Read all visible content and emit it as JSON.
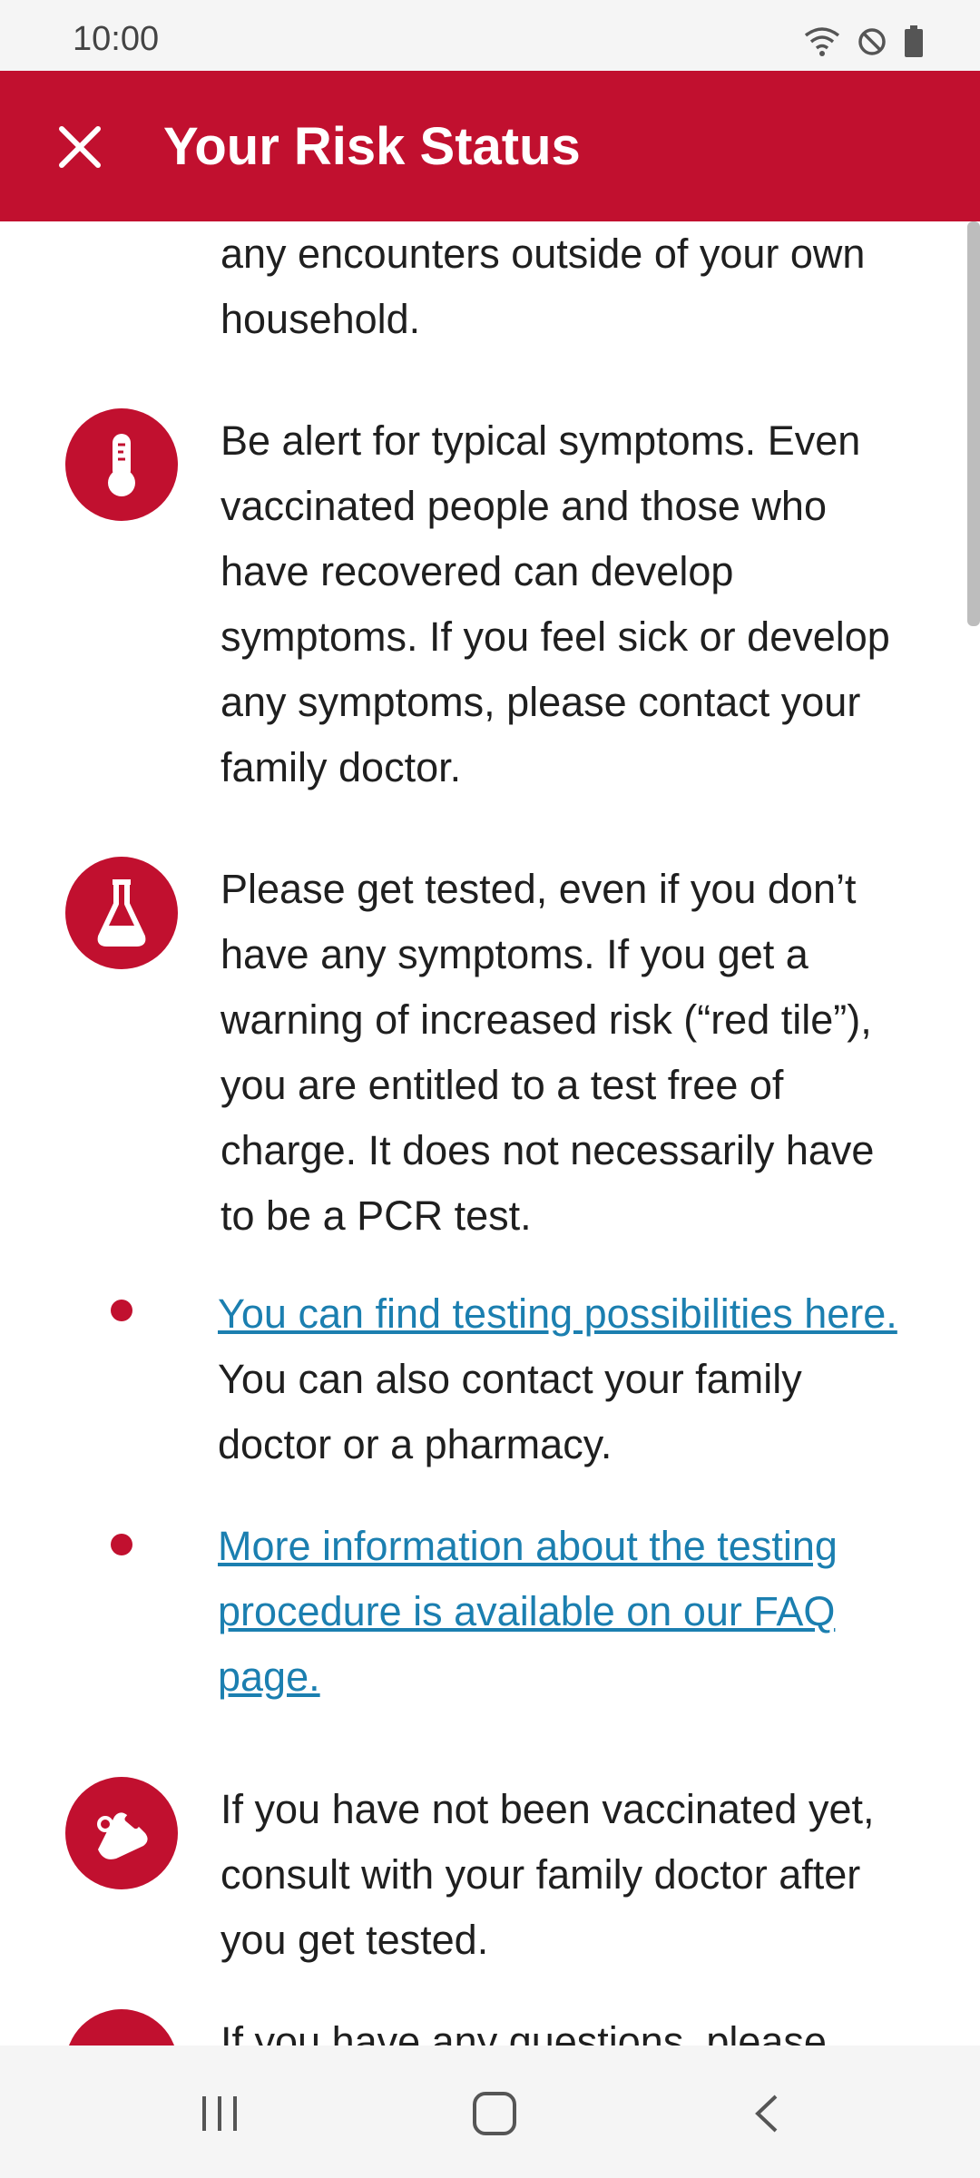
{
  "status_bar": {
    "time": "10:00"
  },
  "app_bar": {
    "title": "Your Risk Status"
  },
  "content": {
    "intro_tail": "any encounters outside of your own household.",
    "symptoms_text": "Be alert for typical symptoms. Even vaccinated people and those who have recovered can develop symptoms. If you feel sick or develop any symptoms, please contact your family doctor.",
    "testing_text": "Please get tested, even if you don’t have any symptoms. If you get a warning of increased risk (“red tile”), you are entitled to a test free of charge. It does not necessarily have to be a PCR test.",
    "bullet1_link": "You can find testing possibilities here.",
    "bullet1_rest": " You can also contact your family doctor or a pharmacy.",
    "bullet2_link": "More information about the testing procedure is available on our FAQ page.",
    "vaccination_text": "If you have not been vaccinated yet, consult with your family doctor after you get tested.",
    "questions_text_partial": "If you have any questions, please"
  },
  "colors": {
    "brand": "#c1102f",
    "link": "#1b7fb0"
  }
}
